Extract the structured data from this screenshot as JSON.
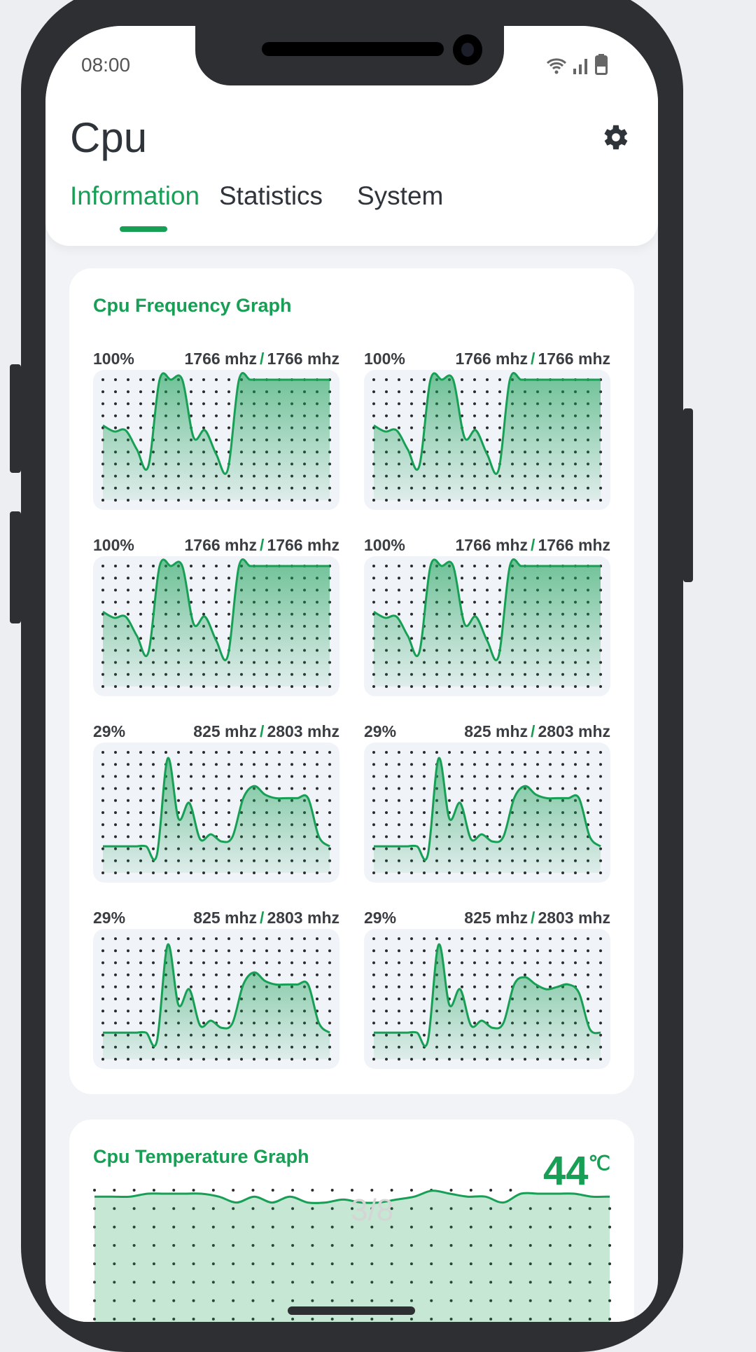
{
  "status_bar": {
    "time": "08:00",
    "icons": [
      "wifi-icon",
      "signal-icon",
      "battery-icon"
    ]
  },
  "header": {
    "title": "Cpu",
    "settings_icon": "gear-icon",
    "tabs": [
      {
        "label": "Information",
        "active": true
      },
      {
        "label": "Statistics",
        "active": false
      },
      {
        "label": "System",
        "active": false
      }
    ]
  },
  "accent_color": "#17a055",
  "frequency_card": {
    "title": "Cpu Frequency Graph",
    "cores": [
      {
        "percent": "100%",
        "current": "1766 mhz",
        "max": "1766 mhz"
      },
      {
        "percent": "100%",
        "current": "1766 mhz",
        "max": "1766 mhz"
      },
      {
        "percent": "100%",
        "current": "1766 mhz",
        "max": "1766 mhz"
      },
      {
        "percent": "100%",
        "current": "1766 mhz",
        "max": "1766 mhz"
      },
      {
        "percent": "29%",
        "current": "825 mhz",
        "max": "2803 mhz"
      },
      {
        "percent": "29%",
        "current": "825 mhz",
        "max": "2803 mhz"
      },
      {
        "percent": "29%",
        "current": "825 mhz",
        "max": "2803 mhz"
      },
      {
        "percent": "29%",
        "current": "825 mhz",
        "max": "2803 mhz"
      }
    ]
  },
  "temperature_card": {
    "title": "Cpu Temperature Graph",
    "value": "44",
    "unit": "℃",
    "page_indicator": "3/8"
  },
  "chart_data": [
    {
      "type": "area",
      "title": "Cpu Frequency Graph",
      "ylim": [
        0,
        100
      ],
      "grid": "dotted",
      "series": [
        {
          "values": [
            62,
            57,
            58,
            42,
            28,
            100,
            100,
            100,
            52,
            58,
            38,
            25,
            100,
            100,
            100,
            100,
            100,
            100,
            100,
            100,
            100
          ]
        },
        {
          "values": [
            62,
            57,
            58,
            42,
            28,
            100,
            100,
            100,
            52,
            58,
            38,
            25,
            100,
            100,
            100,
            100,
            100,
            100,
            100,
            100,
            100
          ]
        },
        {
          "values": [
            62,
            57,
            58,
            42,
            28,
            100,
            100,
            100,
            52,
            58,
            38,
            25,
            100,
            100,
            100,
            100,
            100,
            100,
            100,
            100,
            100
          ]
        },
        {
          "values": [
            62,
            57,
            58,
            42,
            28,
            100,
            100,
            100,
            52,
            58,
            38,
            25,
            100,
            100,
            100,
            100,
            100,
            100,
            100,
            100,
            100
          ]
        },
        {
          "values": [
            22,
            22,
            22,
            22,
            22,
            15,
            95,
            45,
            58,
            28,
            32,
            26,
            30,
            62,
            72,
            65,
            62,
            62,
            62,
            62,
            30,
            22
          ]
        },
        {
          "values": [
            22,
            22,
            22,
            22,
            22,
            15,
            95,
            45,
            58,
            28,
            32,
            26,
            30,
            62,
            72,
            65,
            62,
            62,
            62,
            62,
            30,
            22
          ]
        },
        {
          "values": [
            22,
            22,
            22,
            22,
            22,
            15,
            95,
            45,
            58,
            28,
            32,
            26,
            30,
            62,
            72,
            65,
            62,
            62,
            62,
            62,
            30,
            22
          ]
        },
        {
          "values": [
            22,
            22,
            22,
            22,
            22,
            15,
            95,
            45,
            58,
            28,
            32,
            26,
            30,
            62,
            68,
            62,
            58,
            60,
            62,
            55,
            25,
            22
          ]
        }
      ]
    },
    {
      "type": "area",
      "title": "Cpu Temperature Graph",
      "ylim": [
        0,
        100
      ],
      "grid": "dotted",
      "values": [
        44,
        44,
        44,
        45,
        45,
        45,
        45,
        44,
        42,
        44,
        42,
        44,
        42,
        42,
        43,
        42,
        42,
        43,
        44,
        46,
        45,
        44,
        44,
        42,
        45,
        45,
        45,
        45,
        44,
        44
      ]
    }
  ]
}
